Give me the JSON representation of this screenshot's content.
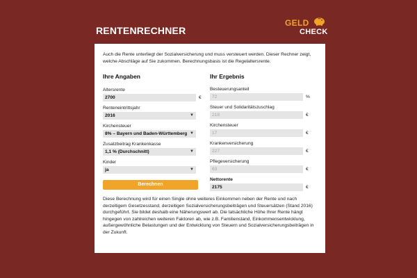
{
  "header": {
    "title": "RENTENRECHNER",
    "logo_line1": "GELD",
    "logo_line2": "CHECK",
    "logo_icon": "piggy-bank-icon"
  },
  "intro": "Auch die Rente unterliegt der Sozialversicherung und muss versteuert werden. Dieser Rechner zeigt, welche Abschläge auf Sie zukommen. Berechnungsbasis ist die Regelaltersrente.",
  "inputs": {
    "title": "Ihre Angaben",
    "altersrente": {
      "label": "Altersrente",
      "value": "2700",
      "unit": "€"
    },
    "renteneintrittsjahr": {
      "label": "Renteneintrittsjahr",
      "value": "2016"
    },
    "kirchensteuer": {
      "label": "Kirchensteuer",
      "value": "8% – Bayern und Baden-Württemberg"
    },
    "zusatzbeitrag": {
      "label": "Zusatzbeitrag Krankenkasse",
      "value": "1,1 % (Durchschnitt)"
    },
    "kinder": {
      "label": "Kinder",
      "value": "ja"
    },
    "calculate_label": "Berechnen"
  },
  "results": {
    "title": "Ihr Ergebnis",
    "besteuerungsanteil": {
      "label": "Besteuerungsanteil",
      "value": "72",
      "unit": "%"
    },
    "steuer_soli": {
      "label": "Steuer und Solidaritätszuschlag",
      "value": "218",
      "unit": "€"
    },
    "kirchensteuer": {
      "label": "Kirchensteuer",
      "value": "17",
      "unit": "€"
    },
    "krankenversicherung": {
      "label": "Krankenversicherung",
      "value": "227",
      "unit": "€"
    },
    "pflegeversicherung": {
      "label": "Pflegeversicherung",
      "value": "63",
      "unit": "€"
    },
    "nettorente": {
      "label": "Nettorente",
      "value": "2175",
      "unit": "€"
    }
  },
  "footer": "Diese Berechnung wird für einen Single ohne weiteres Einkommen neben der Rente und nach derzeitigem Gesetzesstand, derzeitigen Sozialversicherungsbeiträgen und Steuersätzen (Stand 2016) durchgeführt. Sie bildet deshalb eine Näherungswert ab. Die tatsächliche Höhe Ihrer Rente hängt hingegen von zahlreichen weiteren Faktoren ab, wie z.B. Familienstand, Einkommensentwicklung, außergewöhnliche Belastungen und der Entwicklung von Steuern und Sozialversicherungsbeiträgen in der Zukunft.",
  "colors": {
    "background": "#7a2823",
    "accent": "#f0a52a",
    "card": "#ffffff",
    "field": "#e5e5e5"
  }
}
